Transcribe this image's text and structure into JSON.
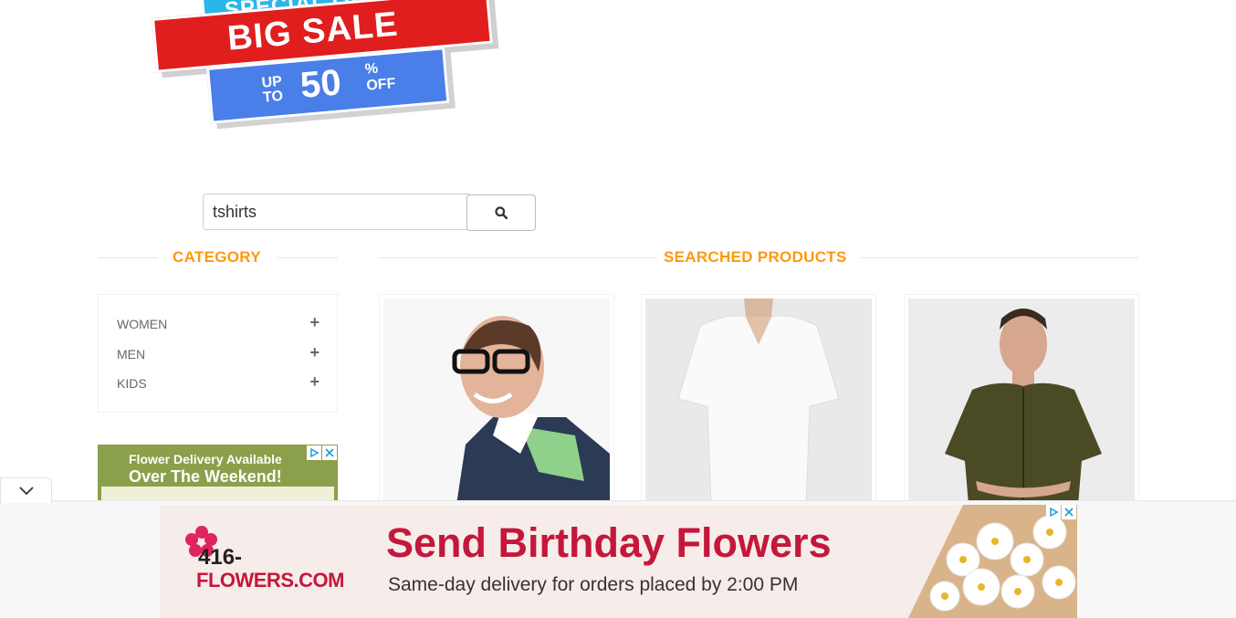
{
  "banner": {
    "special_offer": "SPECIAL OFFER",
    "big_sale": "BIG SALE",
    "up": "UP",
    "to": "TO",
    "percent": "50",
    "percent_sign": "%",
    "off": "OFF"
  },
  "search": {
    "value": "tshirts"
  },
  "category": {
    "heading": "CATEGORY",
    "items": [
      {
        "label": "WOMEN"
      },
      {
        "label": "MEN"
      },
      {
        "label": "KIDS"
      }
    ]
  },
  "products": {
    "heading": "SEARCHED PRODUCTS"
  },
  "side_ad": {
    "line1": "Flower Delivery Available",
    "line2": "Over The Weekend!"
  },
  "bottom_ad": {
    "logo_number": "416-",
    "logo_name": "FLOWERS.COM",
    "headline": "Send Birthday Flowers",
    "subline": "Same-day delivery for orders placed by 2:00 PM"
  },
  "colors": {
    "accent": "#fe980f",
    "ad_red": "#c4173b",
    "banner_red": "#e01e1e",
    "banner_blue": "#4a7ee8",
    "banner_cyan": "#2ab6e8"
  }
}
